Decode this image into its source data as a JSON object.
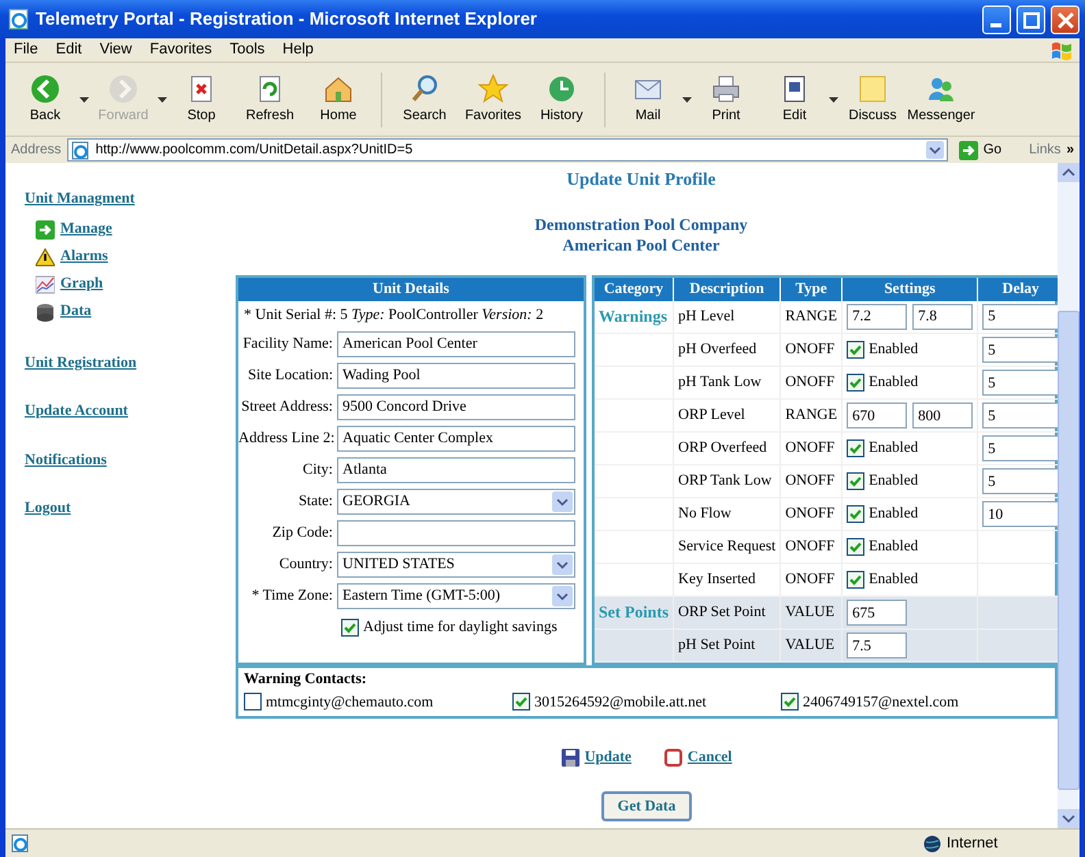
{
  "window": {
    "title": "Telemetry Portal - Registration - Microsoft Internet Explorer"
  },
  "menu": [
    "File",
    "Edit",
    "View",
    "Favorites",
    "Tools",
    "Help"
  ],
  "toolbar": [
    {
      "label": "Back",
      "disabled": false,
      "dropdown": true
    },
    {
      "label": "Forward",
      "disabled": true,
      "dropdown": true
    },
    {
      "label": "Stop",
      "disabled": false,
      "dropdown": false
    },
    {
      "label": "Refresh",
      "disabled": false,
      "dropdown": false
    },
    {
      "label": "Home",
      "disabled": false,
      "dropdown": false
    },
    {
      "label": "Search",
      "disabled": false,
      "dropdown": false
    },
    {
      "label": "Favorites",
      "disabled": false,
      "dropdown": false
    },
    {
      "label": "History",
      "disabled": false,
      "dropdown": false
    },
    {
      "label": "Mail",
      "disabled": false,
      "dropdown": true
    },
    {
      "label": "Print",
      "disabled": false,
      "dropdown": false
    },
    {
      "label": "Edit",
      "disabled": false,
      "dropdown": true
    },
    {
      "label": "Discuss",
      "disabled": false,
      "dropdown": false
    },
    {
      "label": "Messenger",
      "disabled": false,
      "dropdown": false
    }
  ],
  "address": {
    "label": "Address",
    "url": "http://www.poolcomm.com/UnitDetail.aspx?UnitID=5",
    "go": "Go",
    "links": "Links",
    "more": "»"
  },
  "sidebar": {
    "heading": "Unit Managment",
    "items": [
      "Manage",
      "Alarms",
      "Graph",
      "Data"
    ],
    "links": [
      "Unit Registration",
      "Update Account",
      "Notifications",
      "Logout"
    ]
  },
  "page": {
    "title": "Update Unit Profile",
    "company": [
      "Demonstration Pool Company",
      "American Pool Center"
    ]
  },
  "unit_details": {
    "title": "Unit Details",
    "serial": [
      {
        "label": "* Unit Serial #:",
        "value": "5",
        "italic": false
      },
      {
        "label": "Type:",
        "value": "PoolController",
        "italic": true
      },
      {
        "label": "Version:",
        "value": "2",
        "italic": true
      }
    ],
    "fields": [
      {
        "label": "Facility Name:",
        "value": "American Pool Center",
        "kind": "text"
      },
      {
        "label": "Site Location:",
        "value": "Wading Pool",
        "kind": "text"
      },
      {
        "label": "Street Address:",
        "value": "9500 Concord Drive",
        "kind": "text"
      },
      {
        "label": "Address Line 2:",
        "value": "Aquatic Center Complex",
        "kind": "text"
      },
      {
        "label": "City:",
        "value": "Atlanta",
        "kind": "text"
      },
      {
        "label": "State:",
        "value": "GEORGIA",
        "kind": "select"
      },
      {
        "label": "Zip Code:",
        "kind": "text"
      },
      {
        "label": "Country:",
        "value": "UNITED STATES",
        "kind": "select"
      },
      {
        "label": "* Time Zone:",
        "value": "Eastern Time (GMT-5:00)",
        "kind": "select"
      }
    ],
    "daylight": {
      "label": "Adjust time for daylight savings",
      "checked": true
    }
  },
  "settings": {
    "columns": [
      "Category",
      "Description",
      "Type",
      "Settings",
      "Delay"
    ],
    "groups": [
      {
        "category": "Warnings",
        "shaded": false,
        "rows": [
          {
            "description": "pH Level",
            "type": "RANGE",
            "kind": "range",
            "low": "7.2",
            "high": "7.8",
            "delay": "5"
          },
          {
            "description": "pH Overfeed",
            "type": "ONOFF",
            "kind": "onoff",
            "label": "Enabled",
            "checked": true,
            "delay": "5"
          },
          {
            "description": "pH Tank Low",
            "type": "ONOFF",
            "kind": "onoff",
            "label": "Enabled",
            "checked": true,
            "delay": "5"
          },
          {
            "description": "ORP Level",
            "type": "RANGE",
            "kind": "range",
            "low": "670",
            "high": "800",
            "delay": "5"
          },
          {
            "description": "ORP Overfeed",
            "type": "ONOFF",
            "kind": "onoff",
            "label": "Enabled",
            "checked": true,
            "delay": "5"
          },
          {
            "description": "ORP Tank Low",
            "type": "ONOFF",
            "kind": "onoff",
            "label": "Enabled",
            "checked": true,
            "delay": "5"
          },
          {
            "description": "No Flow",
            "type": "ONOFF",
            "kind": "onoff",
            "label": "Enabled",
            "checked": true,
            "delay": "10"
          },
          {
            "description": "Service Request",
            "type": "ONOFF",
            "kind": "onoff",
            "label": "Enabled",
            "checked": true
          },
          {
            "description": "Key Inserted",
            "type": "ONOFF",
            "kind": "onoff",
            "label": "Enabled",
            "checked": true
          }
        ]
      },
      {
        "category": "Set Points",
        "shaded": true,
        "rows": [
          {
            "description": "ORP Set Point",
            "type": "VALUE",
            "kind": "value",
            "value": "675"
          },
          {
            "description": "pH Set Point",
            "type": "VALUE",
            "kind": "value",
            "value": "7.5"
          }
        ]
      }
    ]
  },
  "contacts": {
    "title": "Warning Contacts:",
    "items": [
      {
        "address": "mtmcginty@chemauto.com",
        "checked": false
      },
      {
        "address": "3015264592@mobile.att.net",
        "checked": true
      },
      {
        "address": "2406749157@nextel.com",
        "checked": true
      }
    ]
  },
  "actions": [
    {
      "label": "Update",
      "kind": "save"
    },
    {
      "label": "Cancel",
      "kind": "cancel"
    }
  ],
  "get_data": "Get Data",
  "status": {
    "zone": "Internet"
  }
}
